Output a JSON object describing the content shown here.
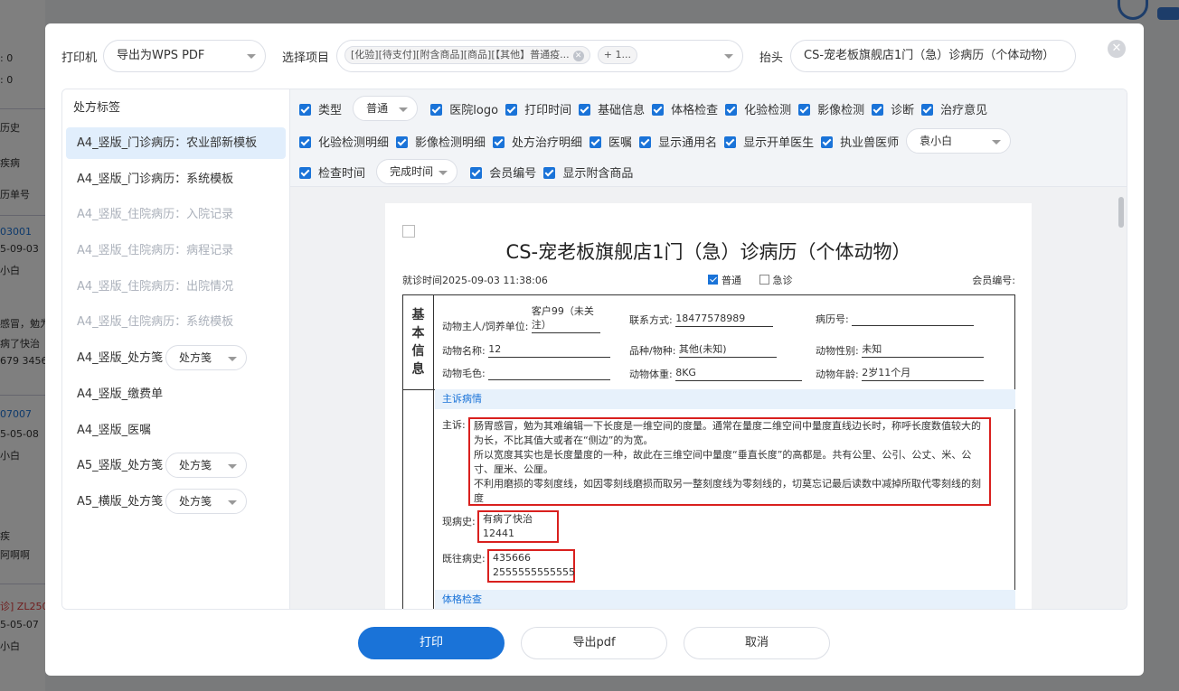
{
  "background": {
    "left_texts": [
      ": 0",
      ": 0",
      "历史",
      "疾病",
      "历单号",
      "03001",
      "5-09-03",
      "小白",
      "感冒，勉为",
      "病了快治",
      "679 3456",
      "07007",
      "5-05-08",
      "小白",
      "疾",
      "阿啊啊",
      "诊] ZL250",
      "5-05-07",
      "小白"
    ]
  },
  "header": {
    "printer_label": "打印机",
    "printer_value": "导出为WPS PDF",
    "project_label": "选择项目",
    "project_tag": "[化验][待支付][附含商品][商品][【其他】普通疫...",
    "project_more": "+ 1...",
    "header_label": "抬头",
    "header_value": "CS-宠老板旗舰店1门（急）诊病历（个体动物）"
  },
  "sidebar": {
    "title": "处方标签",
    "items": [
      {
        "label": "A4_竖版_门诊病历：农业部新模板",
        "state": "active"
      },
      {
        "label": "A4_竖版_门诊病历：系统模板",
        "state": "normal"
      },
      {
        "label": "A4_竖版_住院病历：入院记录",
        "state": "dim"
      },
      {
        "label": "A4_竖版_住院病历：病程记录",
        "state": "dim"
      },
      {
        "label": "A4_竖版_住院病历：出院情况",
        "state": "dim"
      },
      {
        "label": "A4_竖版_住院病历：系统模板",
        "state": "dim"
      },
      {
        "label": "A4_竖版_处方笺",
        "state": "normal",
        "select": "处方笺"
      },
      {
        "label": "A4_竖版_缴费单",
        "state": "normal"
      },
      {
        "label": "A4_竖版_医嘱",
        "state": "normal"
      },
      {
        "label": "A5_竖版_处方笺",
        "state": "normal",
        "select": "处方笺"
      },
      {
        "label": "A5_横版_处方笺",
        "state": "normal",
        "select": "处方笺"
      }
    ]
  },
  "options": {
    "row1": {
      "type_label": "类型",
      "type_value": "普通",
      "items": [
        "医院logo",
        "打印时间",
        "基础信息",
        "体格检查",
        "化验检测",
        "影像检测",
        "诊断",
        "治疗意见"
      ]
    },
    "row2": {
      "items": [
        "化验检测明细",
        "影像检测明细",
        "处方治疗明细",
        "医嘱",
        "显示通用名",
        "显示开单医生",
        "执业兽医师"
      ],
      "vet_value": "袁小白"
    },
    "row3": {
      "time_label": "检查时间",
      "time_value": "完成时间",
      "items": [
        "会员编号",
        "显示附含商品"
      ]
    }
  },
  "document": {
    "title": "CS-宠老板旗舰店1门（急）诊病历（个体动物）",
    "visit_time": "就诊时间2025-09-03 11:38:06",
    "normal_label": "普通",
    "emergency_label": "急诊",
    "member_label": "会员编号:",
    "basic_header": "基本信息",
    "fields": {
      "owner_label": "动物主人/饲养单位:",
      "owner_value": "客户99（未关注）",
      "phone_label": "联系方式:",
      "phone_value": "18477578989",
      "record_label": "病历号:",
      "record_value": "",
      "name_label": "动物名称:",
      "name_value": "12",
      "breed_label": "品种/物种:",
      "breed_value": "其他(未知)",
      "sex_label": "动物性别:",
      "sex_value": "未知",
      "color_label": "动物毛色:",
      "color_value": "",
      "weight_label": "动物体重:",
      "weight_value": "8KG",
      "age_label": "动物年龄:",
      "age_value": "2岁11个月"
    },
    "complaint_section": "主诉病情",
    "complaint_label": "主诉:",
    "complaint_lines": [
      "肠胃感冒，勉为其难编辑一下长度是一维空间的度量。通常在量度二维空间中量度直线边长时，称呼长度数值较大的",
      "为长，不比其值大或者在“侧边”的为宽。",
      "所以宽度其实也是长度量度的一种，故此在三维空间中量度“垂直长度”的高都是。共有公里、公引、公丈、米、公",
      "寸、厘米、公厘。",
      "不利用磨损的零刻度线，如因零刻线磨损而取另一整刻度线为零刻线的，切莫忘记最后读数中减掉所取代零刻线的刻",
      "度"
    ],
    "present_label": "现病史:",
    "present_lines": [
      "有病了快治",
      "12441"
    ],
    "past_label": "既往病史:",
    "past_lines": [
      "435666",
      "2555555555555"
    ],
    "exam_section": "体格检查"
  },
  "footer": {
    "print": "打印",
    "export": "导出pdf",
    "cancel": "取消"
  },
  "colors": {
    "primary": "#1a73d8",
    "highlight_border": "#d9201e"
  }
}
